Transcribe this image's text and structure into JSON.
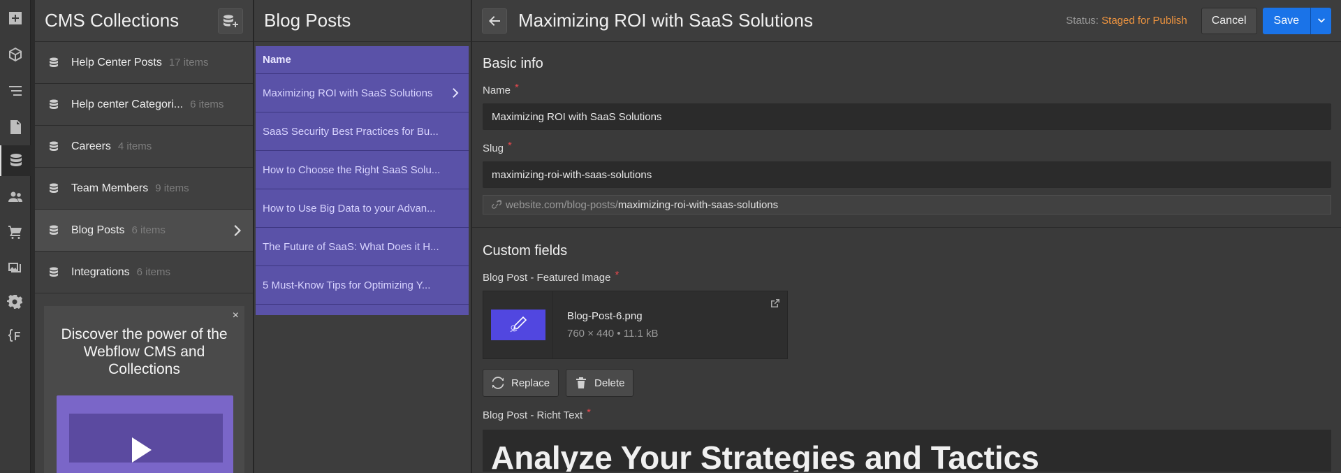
{
  "rail": {
    "icons": [
      "add-icon",
      "box-icon",
      "navigator-icon",
      "pages-icon",
      "cms-database-icon",
      "users-icon",
      "ecommerce-cart-icon",
      "assets-icon",
      "settings-icon",
      "code-icon"
    ]
  },
  "collections": {
    "title": "CMS Collections",
    "items": [
      {
        "name": "Help Center Posts",
        "count": "17 items"
      },
      {
        "name": "Help center Categori...",
        "count": "6 items"
      },
      {
        "name": "Careers",
        "count": "4 items"
      },
      {
        "name": "Team Members",
        "count": "9 items"
      },
      {
        "name": "Blog Posts",
        "count": "6 items"
      },
      {
        "name": "Integrations",
        "count": "6 items"
      }
    ],
    "promo": {
      "close": "×",
      "title": "Discover the power of the Webflow CMS and Collections"
    }
  },
  "items_panel": {
    "title": "Blog Posts",
    "column_header": "Name",
    "rows": [
      "Maximizing ROI with SaaS Solutions",
      "SaaS Security Best Practices for Bu...",
      "How to Choose the Right SaaS Solu...",
      "How to Use Big Data to your Advan...",
      "The Future of SaaS: What Does it H...",
      "5 Must-Know Tips for Optimizing Y..."
    ]
  },
  "editor": {
    "title": "Maximizing ROI with SaaS Solutions",
    "status_label": "Status:",
    "status_value": "Staged for Publish",
    "cancel_label": "Cancel",
    "save_label": "Save",
    "basic_info": {
      "title": "Basic info",
      "name_label": "Name",
      "name_value": "Maximizing ROI with SaaS Solutions",
      "slug_label": "Slug",
      "slug_value": "maximizing-roi-with-saas-solutions",
      "url_prefix": "website.com/blog-posts/",
      "url_slug": "maximizing-roi-with-saas-solutions"
    },
    "custom_fields": {
      "title": "Custom fields",
      "image_label": "Blog Post - Featured Image",
      "image_name": "Blog-Post-6.png",
      "image_meta": "760 × 440 • 11.1 kB",
      "replace_label": "Replace",
      "delete_label": "Delete",
      "rich_label": "Blog Post - Richt Text",
      "rich_heading": "Analyze Your Strategies and Tactics"
    },
    "required_mark": "*"
  },
  "colors": {
    "accent": "#1a73e8",
    "status": "#f0953f",
    "list_highlight": "#5a52a8",
    "required": "#e5484d"
  }
}
